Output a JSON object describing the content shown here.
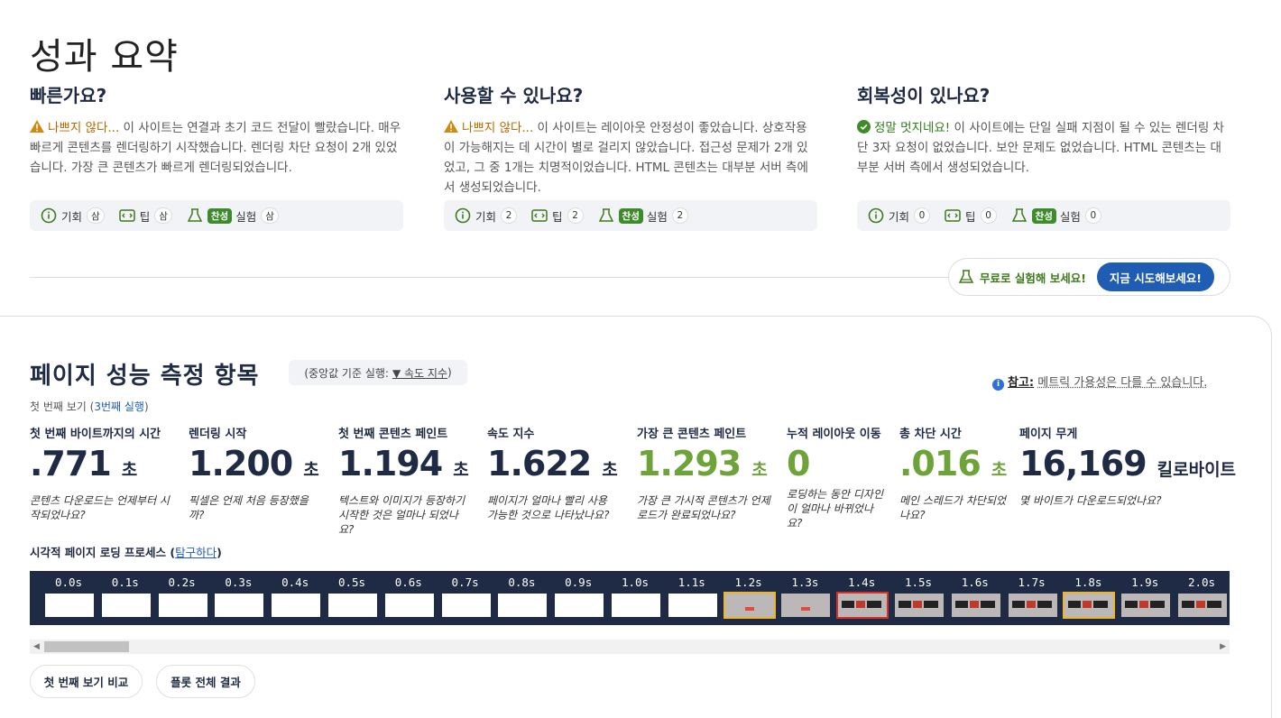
{
  "page_title": "성과 요약",
  "summary": [
    {
      "heading": "빠른가요?",
      "verdict": "나쁘지 않다...",
      "verdict_type": "bad",
      "text": " 이 사이트는 연결과 초기 코드 전달이 빨랐습니다. 매우 빠르게 콘텐츠를 렌더링하기 시작했습니다. 렌더링 차단 요청이 2개 있었습니다. 가장 큰 콘텐츠가 빠르게 렌더링되었습니다.",
      "opportunities_label": "기회",
      "opportunities_count": "삼",
      "tips_label": "팁",
      "tips_count": "삼",
      "experiments_badge": "찬성",
      "experiments_label": "실험",
      "experiments_count": "삼"
    },
    {
      "heading": "사용할 수 있나요?",
      "verdict": "나쁘지 않다...",
      "verdict_type": "bad",
      "text": " 이 사이트는 레이아웃 안정성이 좋았습니다. 상호작용이 가능해지는 데 시간이 별로 걸리지 않았습니다. 접근성 문제가 2개 있었고, 그 중 1개는 치명적이었습니다. HTML 콘텐츠는 대부분 서버 측에서 생성되었습니다.",
      "opportunities_label": "기회",
      "opportunities_count": "2",
      "tips_label": "팁",
      "tips_count": "2",
      "experiments_badge": "찬성",
      "experiments_label": "실험",
      "experiments_count": "2"
    },
    {
      "heading": "회복성이 있나요?",
      "verdict": "정말 멋지네요!",
      "verdict_type": "good",
      "text": " 이 사이트에는 단일 실패 지점이 될 수 있는 렌더링 차단 3자 요청이 없었습니다. 보안 문제도 없었습니다. HTML 콘텐츠는 대부분 서버 측에서 생성되었습니다.",
      "opportunities_label": "기회",
      "opportunities_count": "0",
      "tips_label": "팁",
      "tips_count": "0",
      "experiments_badge": "찬성",
      "experiments_label": "실험",
      "experiments_count": "0"
    }
  ],
  "cta": {
    "text": "무료로 실험해 보세요!",
    "button": "지금 시도해보세요!"
  },
  "metrics_section": {
    "title": "페이지 성능 측정 항목",
    "median_prefix": "(중앙값 기준 실행:",
    "median_link": "▼ 속도 지수",
    "median_suffix": ")",
    "note_label": "참고:",
    "note_text": "메트릭 가용성은 다를 수 있습니다.",
    "view_prefix": "첫 번째 보기 (",
    "view_link": "3번째 실행",
    "view_suffix": ")"
  },
  "metrics": [
    {
      "label": "첫 번째 바이트까지의 시간",
      "value": ".771",
      "unit": "초",
      "desc": "콘텐츠 다운로드는 언제부터 시작되었나요?",
      "color": "#1f2a44"
    },
    {
      "label": "렌더링 시작",
      "value": "1.200",
      "unit": "초",
      "desc": "픽셀은 언제 처음 등장했을까?",
      "color": "#1f2a44"
    },
    {
      "label": "첫 번째 콘텐츠 페인트",
      "value": "1.194",
      "unit": "초",
      "desc": "텍스트와 이미지가 등장하기 시작한 것은 얼마나 되었나요?",
      "color": "#1f2a44"
    },
    {
      "label": "속도 지수",
      "value": "1.622",
      "unit": "초",
      "desc": "페이지가 얼마나 빨리 사용 가능한 것으로 나타났나요?",
      "color": "#1f2a44"
    },
    {
      "label": "가장 큰 콘텐츠 페인트",
      "value": "1.293",
      "unit": "초",
      "desc": "가장 큰 가시적 콘텐츠가 언제 로드가 완료되었나요?",
      "color": "#6ea33a"
    },
    {
      "label": "누적 레이아웃 이동",
      "value": "0",
      "unit": "",
      "desc": "로딩하는 동안 디자인이 얼마나 바뀌었나요?",
      "color": "#6ea33a"
    },
    {
      "label": "총 차단 시간",
      "value": ".016",
      "unit": "초",
      "desc": "메인 스레드가 차단되었나요?",
      "color": "#6ea33a"
    },
    {
      "label": "페이지 무게",
      "value": "16,169",
      "unit": "킬로바이트",
      "desc": "몇 바이트가 다운로드되었나요?",
      "color": "#1f2a44"
    }
  ],
  "filmstrip": {
    "title": "시각적 페이지 로딩 프로세스",
    "link_open": "(",
    "link": "탐구하다",
    "link_close": ")",
    "frames": [
      {
        "time": "0.0s",
        "state": "blank",
        "highlight": "none"
      },
      {
        "time": "0.1s",
        "state": "blank",
        "highlight": "none"
      },
      {
        "time": "0.2s",
        "state": "blank",
        "highlight": "none"
      },
      {
        "time": "0.3s",
        "state": "blank",
        "highlight": "none"
      },
      {
        "time": "0.4s",
        "state": "blank",
        "highlight": "none"
      },
      {
        "time": "0.5s",
        "state": "blank",
        "highlight": "none"
      },
      {
        "time": "0.6s",
        "state": "blank",
        "highlight": "none"
      },
      {
        "time": "0.7s",
        "state": "blank",
        "highlight": "none"
      },
      {
        "time": "0.8s",
        "state": "blank",
        "highlight": "none"
      },
      {
        "time": "0.9s",
        "state": "blank",
        "highlight": "none"
      },
      {
        "time": "1.0s",
        "state": "blank",
        "highlight": "none"
      },
      {
        "time": "1.1s",
        "state": "blank",
        "highlight": "none"
      },
      {
        "time": "1.2s",
        "state": "partial",
        "highlight": "yellow"
      },
      {
        "time": "1.3s",
        "state": "partial",
        "highlight": "none"
      },
      {
        "time": "1.4s",
        "state": "content",
        "highlight": "red"
      },
      {
        "time": "1.5s",
        "state": "content",
        "highlight": "none"
      },
      {
        "time": "1.6s",
        "state": "content",
        "highlight": "none"
      },
      {
        "time": "1.7s",
        "state": "content",
        "highlight": "none"
      },
      {
        "time": "1.8s",
        "state": "content",
        "highlight": "yellow"
      },
      {
        "time": "1.9s",
        "state": "content",
        "highlight": "none"
      },
      {
        "time": "2.0s",
        "state": "content",
        "highlight": "none"
      }
    ]
  },
  "buttons": {
    "compare": "첫 번째 보기 비교",
    "all_results": "플롯 전체 결과"
  }
}
